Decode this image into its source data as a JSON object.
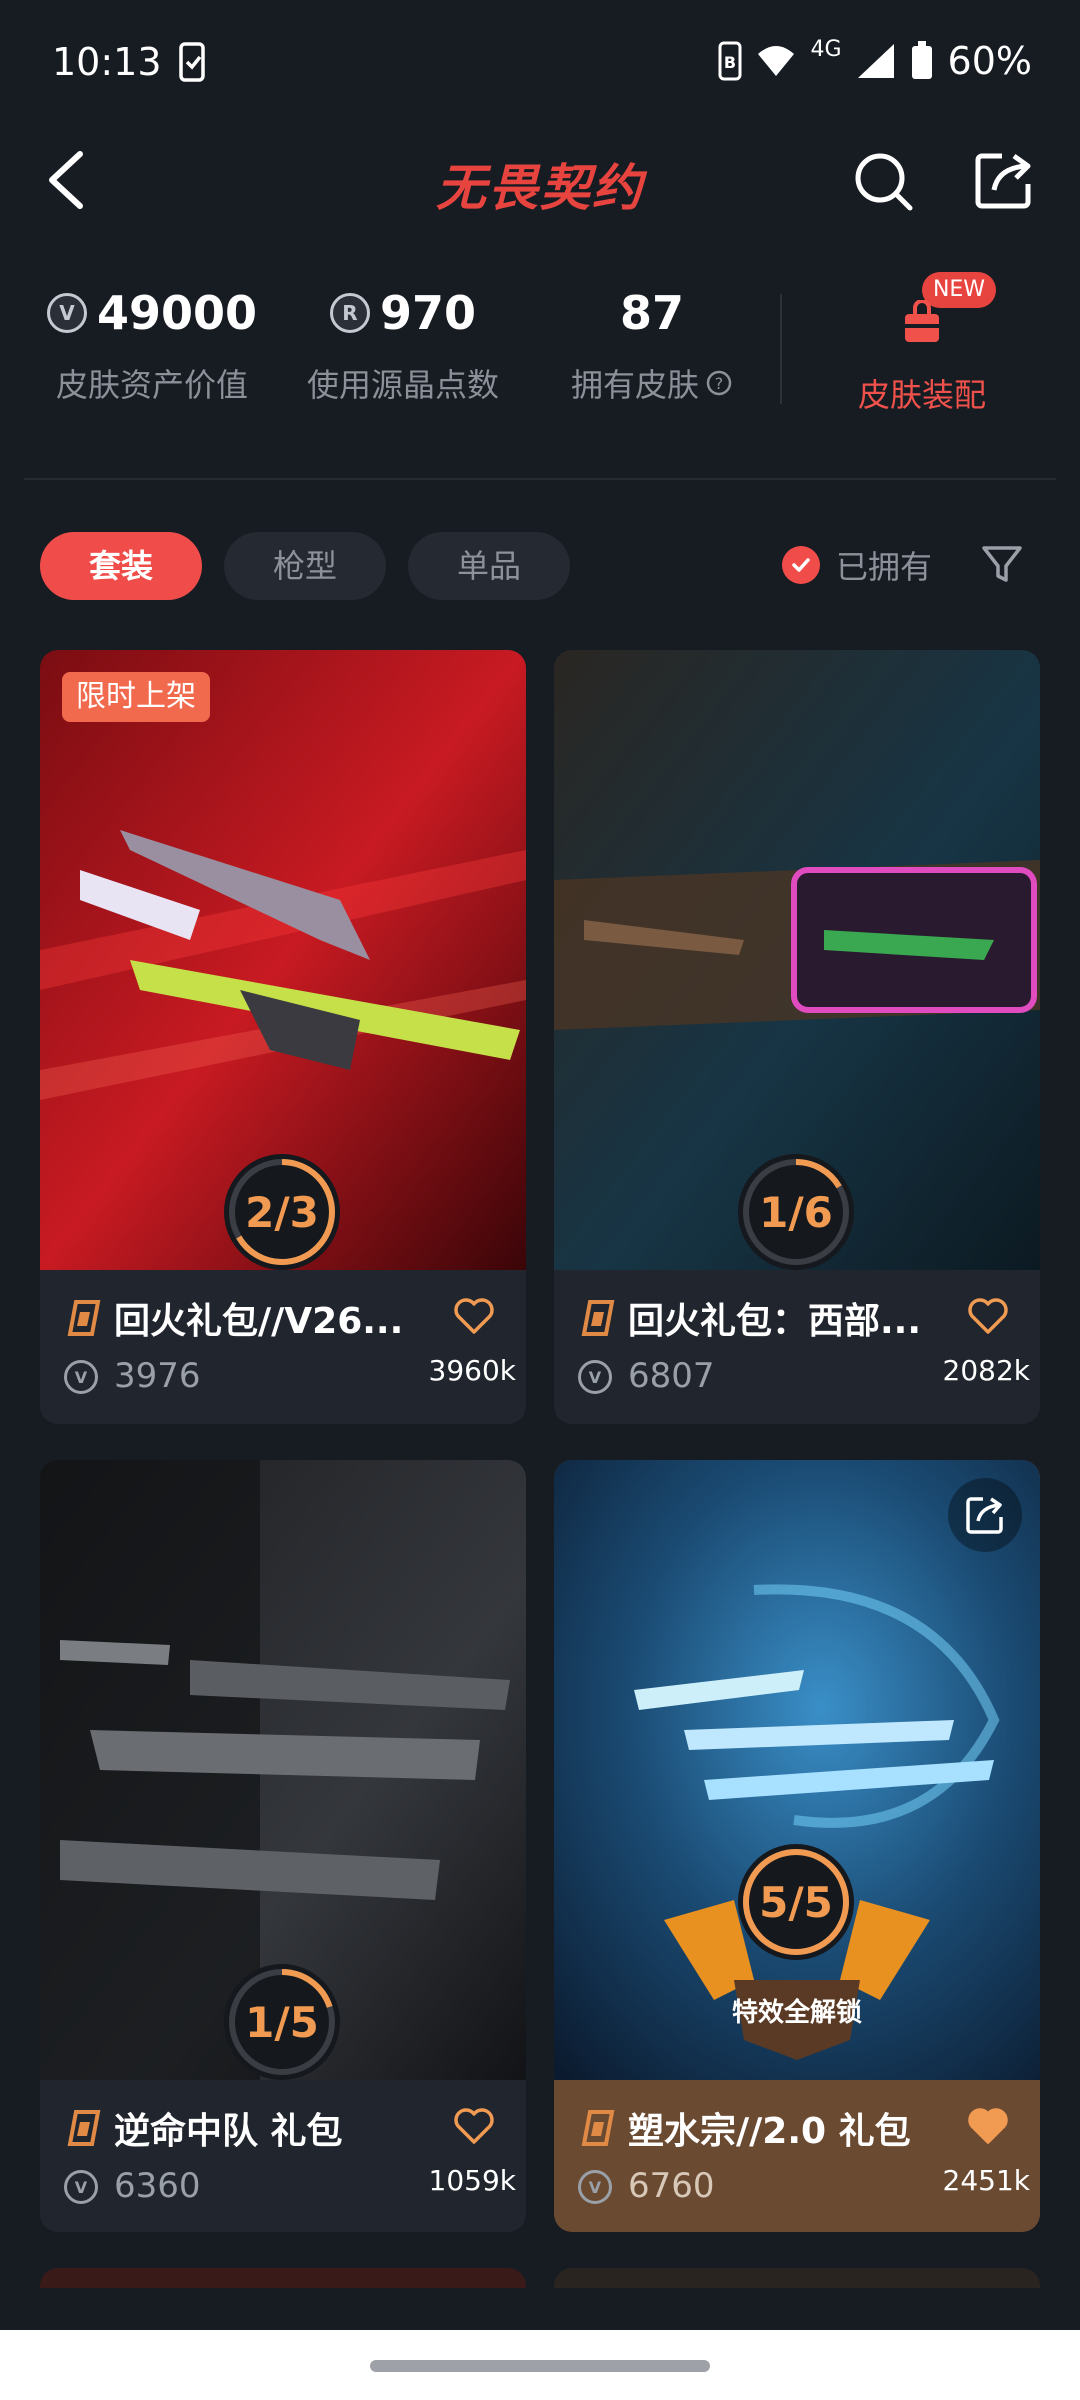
{
  "status": {
    "time": "10:13",
    "network": "4G",
    "battery": "60%"
  },
  "header": {
    "title": "无畏契约"
  },
  "stats": {
    "asset_value": "49000",
    "asset_label": "皮肤资产价值",
    "points": "970",
    "points_label": "使用源晶点数",
    "owned": "87",
    "owned_label": "拥有皮肤",
    "new_badge": "NEW",
    "equip_label": "皮肤装配"
  },
  "tabs": [
    {
      "label": "套装",
      "active": true
    },
    {
      "label": "枪型",
      "active": false
    },
    {
      "label": "单品",
      "active": false
    }
  ],
  "owned_filter": {
    "label": "已拥有",
    "checked": true
  },
  "cards": [
    {
      "title": "回火礼包//V26...",
      "price": "3976",
      "likes": "3960k",
      "progress": "2/3",
      "badge": "限时上架",
      "liked": false
    },
    {
      "title": "回火礼包：西部...",
      "price": "6807",
      "likes": "2082k",
      "progress": "1/6",
      "liked": false
    },
    {
      "title": "逆命中队 礼包",
      "price": "6360",
      "likes": "1059k",
      "progress": "1/5",
      "liked": false
    },
    {
      "title": "塑水宗//2.0 礼包",
      "price": "6760",
      "likes": "2451k",
      "progress": "5/5",
      "unlock_label": "特效全解锁",
      "liked": true
    }
  ],
  "colors": {
    "accent": "#f04d4a",
    "progress": "#f09a52",
    "card_bg": "#20252e",
    "page_bg": "#171b22"
  }
}
